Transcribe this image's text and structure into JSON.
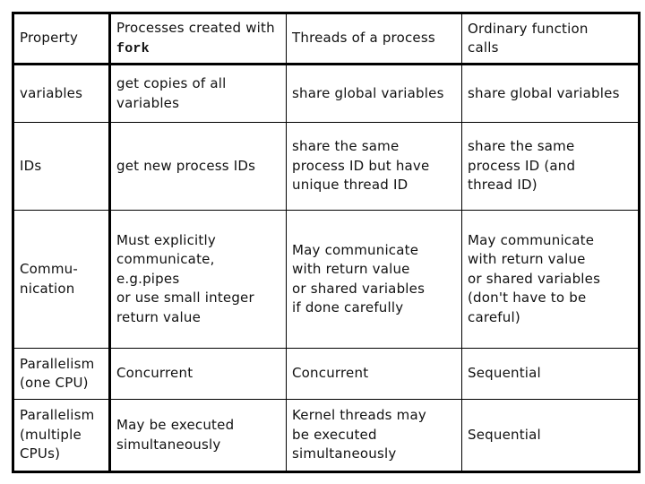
{
  "table": {
    "headers": {
      "property": "Property",
      "fork_prefix": "Processes created with ",
      "fork_code": "fork",
      "threads": "Threads of a process",
      "functions": [
        "Ordinary function",
        "calls"
      ]
    },
    "rows": [
      {
        "property": [
          "variables"
        ],
        "fork": [
          "get copies of all",
          "variables"
        ],
        "threads": [
          "share global variables"
        ],
        "functions": [
          "share global variables"
        ]
      },
      {
        "property": [
          "IDs"
        ],
        "fork": [
          "get new process IDs"
        ],
        "threads": [
          "share the same",
          "process ID but have",
          "unique thread ID"
        ],
        "functions": [
          "share the same",
          "process ID (and",
          "thread ID)"
        ]
      },
      {
        "property": [
          "Commu-",
          "nication"
        ],
        "fork": [
          "Must explicitly",
          "communicate,",
          "e.g.pipes",
          "or use small integer",
          "return value"
        ],
        "threads": [
          "May communicate",
          "with return value",
          "or shared variables",
          "if done carefully"
        ],
        "functions": [
          "May communicate",
          "with return value",
          "or shared variables",
          "(don't have to be",
          "careful)"
        ]
      },
      {
        "property": [
          "Parallelism",
          "(one CPU)"
        ],
        "fork": [
          "Concurrent"
        ],
        "threads": [
          "Concurrent"
        ],
        "functions": [
          "Sequential"
        ]
      },
      {
        "property": [
          "Parallelism",
          "(multiple",
          "CPUs)"
        ],
        "fork": [
          "May be executed",
          "simultaneously"
        ],
        "threads": [
          "Kernel threads may",
          "be executed",
          "simultaneously"
        ],
        "functions": [
          "Sequential"
        ]
      }
    ]
  }
}
